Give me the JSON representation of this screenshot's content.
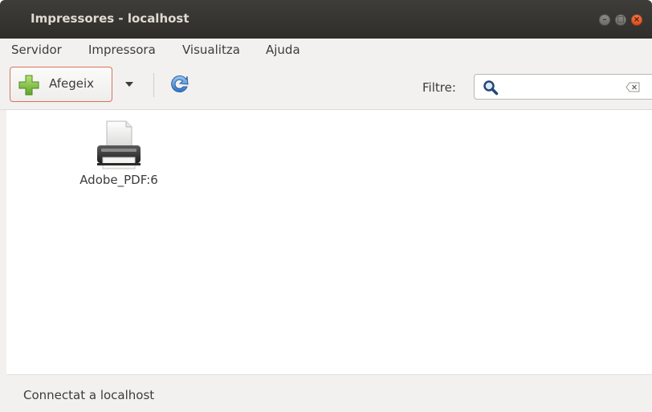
{
  "window": {
    "title": "Impressores - localhost"
  },
  "menubar": {
    "items": [
      {
        "label": "Servidor"
      },
      {
        "label": "Impressora"
      },
      {
        "label": "Visualitza"
      },
      {
        "label": "Ajuda"
      }
    ]
  },
  "toolbar": {
    "add_label": "Afegeix",
    "add_icon": "plus-icon",
    "dropdown_icon": "chevron-down-icon",
    "refresh_icon": "refresh-icon",
    "filter_label": "Filtre:",
    "filter_value": "",
    "filter_placeholder": ""
  },
  "printers": [
    {
      "name": "Adobe_PDF:6",
      "icon": "printer-icon"
    }
  ],
  "statusbar": {
    "text": "Connectat a localhost"
  },
  "colors": {
    "titlebar": "#3e3d39",
    "title_text": "#dfdbd2",
    "accent": "#df4a16",
    "background": "#f2f1f0"
  }
}
